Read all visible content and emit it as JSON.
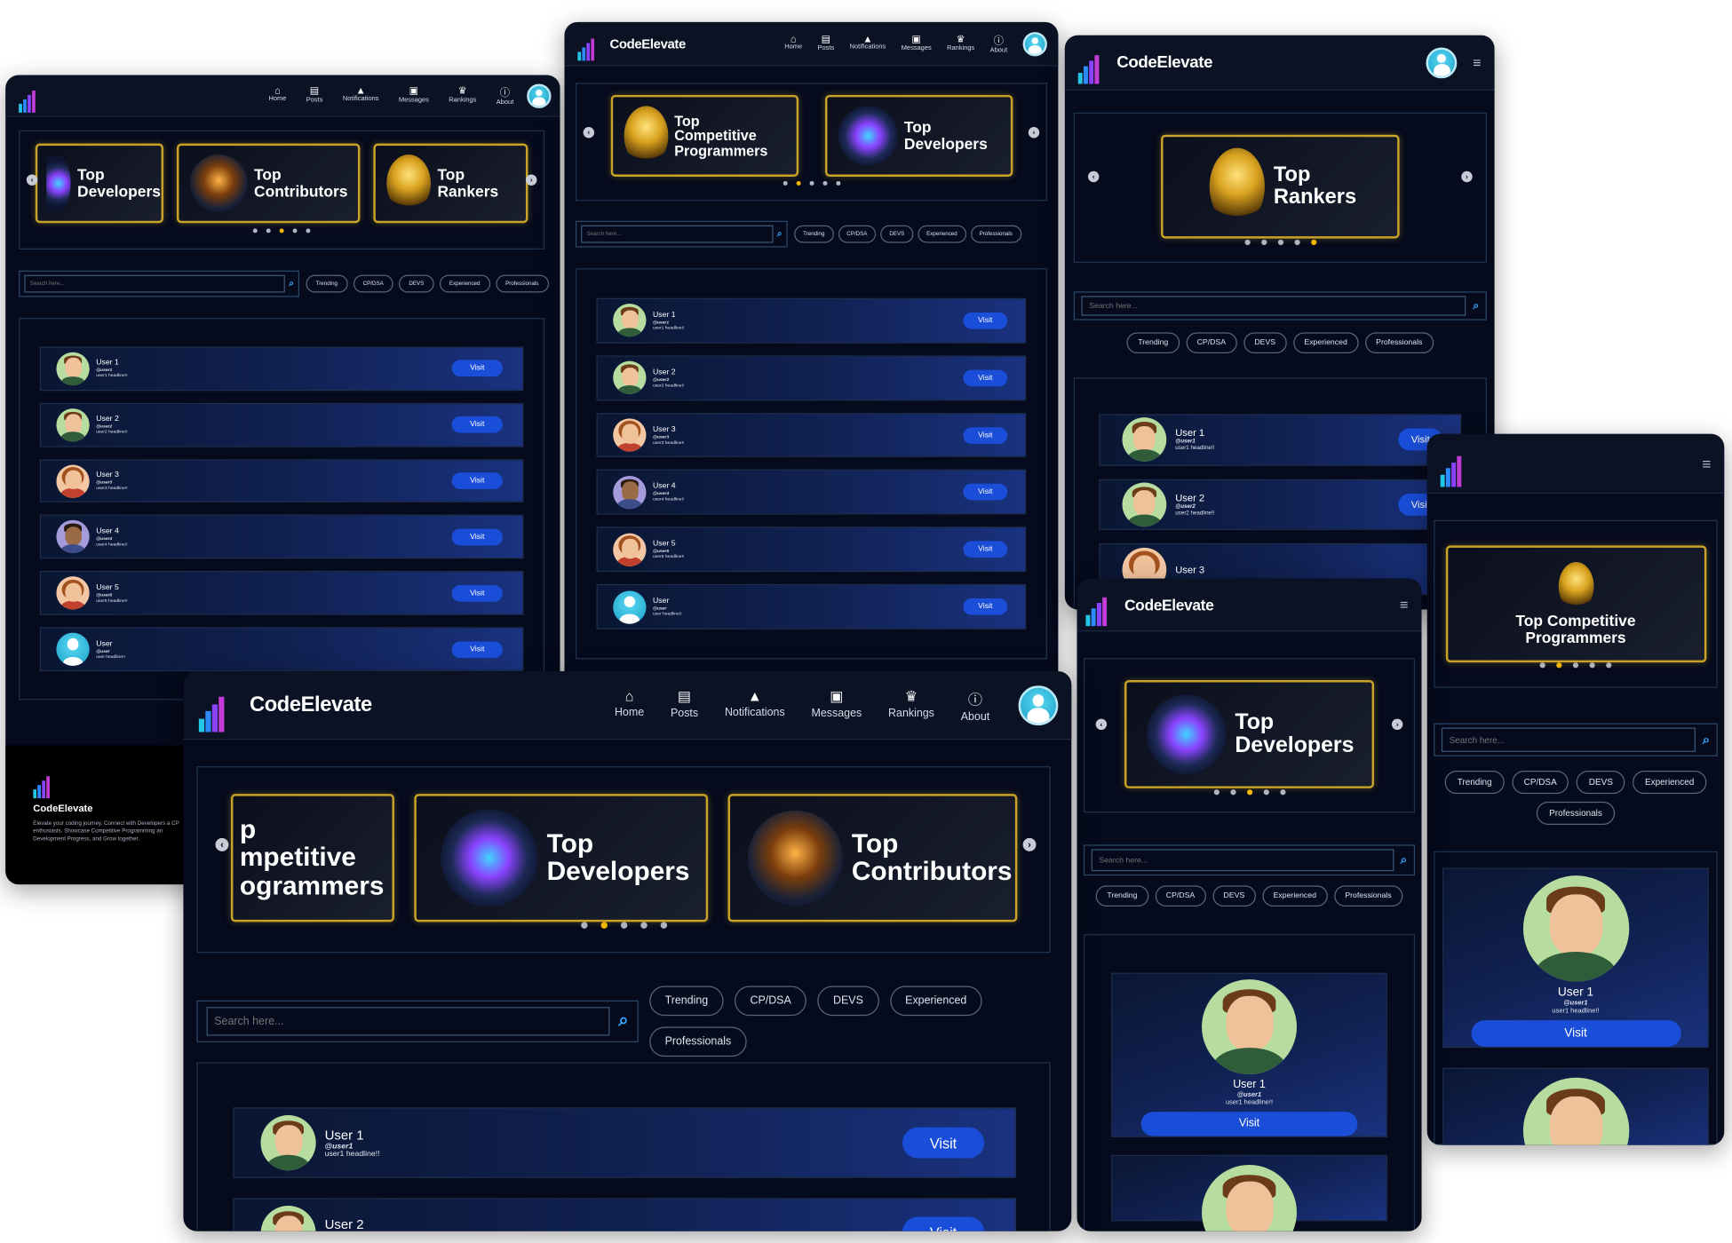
{
  "brand": {
    "name": "CodeElevate",
    "logo_letters": "CODE ELEVATE"
  },
  "nav": {
    "home": "Home",
    "posts": "Posts",
    "notifications": "Notifications",
    "messages": "Messages",
    "rankings": "Rankings",
    "about": "About"
  },
  "carousel": {
    "top_developers": "Top Developers",
    "top_contributors": "Top Contributors",
    "top_rankers": "Top Rankers",
    "top_cp": "Top Competitive Programmers",
    "cp_partial": "p\nmpetitive\nogrammers"
  },
  "search": {
    "placeholder": "Search here..."
  },
  "filters": [
    "Trending",
    "CP/DSA",
    "DEVS",
    "Experienced",
    "Professionals"
  ],
  "visit_label": "Visit",
  "users": [
    {
      "name": "User 1",
      "handle": "@user1",
      "headline": "user1 headline!!",
      "avatar": "male"
    },
    {
      "name": "User 2",
      "handle": "@user2",
      "headline": "user2 headline!!",
      "avatar": "male"
    },
    {
      "name": "User 3",
      "handle": "@user3",
      "headline": "user3 headline!!",
      "avatar": "female"
    },
    {
      "name": "User 4",
      "handle": "@user4",
      "headline": "user4 headline!!",
      "avatar": "dark"
    },
    {
      "name": "User 5",
      "handle": "@user5",
      "headline": "user5 headline!!",
      "avatar": "female"
    },
    {
      "name": "User",
      "handle": "@user",
      "headline": "user headline!!",
      "avatar": "default"
    }
  ],
  "footer": {
    "brand": "CodeElevate",
    "text": "Elevate your coding journey. Connect with Developers a CP enthusiasts. Showcase Competitive Programming an Development Progress, and Grow together."
  },
  "colors": {
    "background": "#050a1c",
    "nav": "#0a1224",
    "gold": "#c9a227",
    "accent_blue": "#1a4ed8",
    "active_dot": "#f5b800"
  },
  "icons": {
    "home": "home-icon",
    "posts": "posts-icon",
    "notifications": "bell-icon",
    "messages": "message-icon",
    "rankings": "trophy-icon",
    "about": "info-icon",
    "search": "search-icon",
    "menu": "hamburger-icon"
  }
}
